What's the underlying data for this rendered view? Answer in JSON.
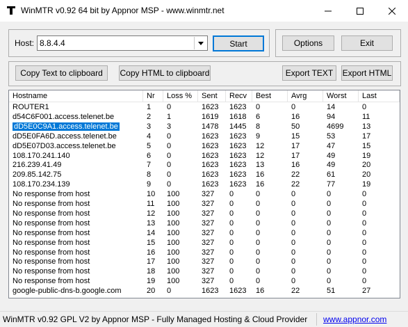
{
  "window": {
    "title": "WinMTR v0.92 64 bit by Appnor MSP - www.winmtr.net"
  },
  "host": {
    "label": "Host:",
    "value": "8.8.4.4"
  },
  "buttons": {
    "start": "Start",
    "options": "Options",
    "exit": "Exit",
    "copy_text": "Copy Text to clipboard",
    "copy_html": "Copy HTML to clipboard",
    "export_text": "Export TEXT",
    "export_html": "Export HTML"
  },
  "table": {
    "columns": [
      "Hostname",
      "Nr",
      "Loss %",
      "Sent",
      "Recv",
      "Best",
      "Avrg",
      "Worst",
      "Last"
    ],
    "selected_row": 2,
    "rows": [
      [
        "ROUTER1",
        "1",
        "0",
        "1623",
        "1623",
        "0",
        "0",
        "14",
        "0"
      ],
      [
        "d54C6F001.access.telenet.be",
        "2",
        "1",
        "1619",
        "1618",
        "6",
        "16",
        "94",
        "11"
      ],
      [
        "dD5E0C9A1.access.telenet.be",
        "3",
        "3",
        "1478",
        "1445",
        "8",
        "50",
        "4699",
        "13"
      ],
      [
        "dD5E0FA6D.access.telenet.be",
        "4",
        "0",
        "1623",
        "1623",
        "9",
        "15",
        "53",
        "17"
      ],
      [
        "dD5E07D03.access.telenet.be",
        "5",
        "0",
        "1623",
        "1623",
        "12",
        "17",
        "47",
        "15"
      ],
      [
        "108.170.241.140",
        "6",
        "0",
        "1623",
        "1623",
        "12",
        "17",
        "49",
        "19"
      ],
      [
        "216.239.41.49",
        "7",
        "0",
        "1623",
        "1623",
        "13",
        "16",
        "49",
        "20"
      ],
      [
        "209.85.142.75",
        "8",
        "0",
        "1623",
        "1623",
        "16",
        "22",
        "61",
        "20"
      ],
      [
        "108.170.234.139",
        "9",
        "0",
        "1623",
        "1623",
        "16",
        "22",
        "77",
        "19"
      ],
      [
        "No response from host",
        "10",
        "100",
        "327",
        "0",
        "0",
        "0",
        "0",
        "0"
      ],
      [
        "No response from host",
        "11",
        "100",
        "327",
        "0",
        "0",
        "0",
        "0",
        "0"
      ],
      [
        "No response from host",
        "12",
        "100",
        "327",
        "0",
        "0",
        "0",
        "0",
        "0"
      ],
      [
        "No response from host",
        "13",
        "100",
        "327",
        "0",
        "0",
        "0",
        "0",
        "0"
      ],
      [
        "No response from host",
        "14",
        "100",
        "327",
        "0",
        "0",
        "0",
        "0",
        "0"
      ],
      [
        "No response from host",
        "15",
        "100",
        "327",
        "0",
        "0",
        "0",
        "0",
        "0"
      ],
      [
        "No response from host",
        "16",
        "100",
        "327",
        "0",
        "0",
        "0",
        "0",
        "0"
      ],
      [
        "No response from host",
        "17",
        "100",
        "327",
        "0",
        "0",
        "0",
        "0",
        "0"
      ],
      [
        "No response from host",
        "18",
        "100",
        "327",
        "0",
        "0",
        "0",
        "0",
        "0"
      ],
      [
        "No response from host",
        "19",
        "100",
        "327",
        "0",
        "0",
        "0",
        "0",
        "0"
      ],
      [
        "google-public-dns-b.google.com",
        "20",
        "0",
        "1623",
        "1623",
        "16",
        "22",
        "51",
        "27"
      ]
    ]
  },
  "status": {
    "text": "WinMTR v0.92 GPL V2 by Appnor MSP - Fully Managed Hosting & Cloud Provider",
    "link": "www.appnor.com"
  },
  "colors": {
    "selection": "#0078d7",
    "link": "#0000ee"
  }
}
